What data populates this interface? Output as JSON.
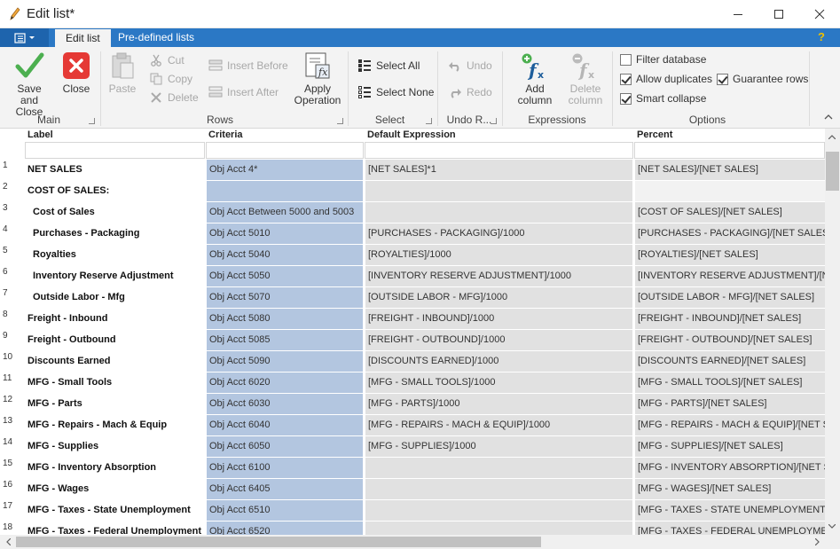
{
  "window": {
    "title": "Edit list*",
    "icons": {
      "app": "pencil-icon",
      "minimize": "minimize-icon",
      "maximize": "maximize-icon",
      "close": "close-icon"
    }
  },
  "tabs": [
    {
      "label": "Edit list",
      "active": true
    },
    {
      "label": "Pre-defined lists",
      "active": false
    }
  ],
  "help": "?",
  "ribbon": {
    "groups": {
      "main": "Main",
      "rows": "Rows",
      "select": "Select",
      "undo": "Undo R...",
      "expressions": "Expressions",
      "options": "Options"
    },
    "buttons": {
      "save_and_close": "Save and\nClose",
      "close": "Close",
      "paste": "Paste",
      "cut": "Cut",
      "copy": "Copy",
      "delete": "Delete",
      "insert_before": "Insert Before",
      "insert_after": "Insert After",
      "apply_operation": "Apply\nOperation",
      "select_all": "Select All",
      "select_none": "Select None",
      "undo": "Undo",
      "redo": "Redo",
      "add_column": "Add column",
      "delete_column": "Delete\ncolumn"
    },
    "options": {
      "filter_database": {
        "label": "Filter database",
        "checked": false
      },
      "allow_duplicates": {
        "label": "Allow duplicates",
        "checked": true
      },
      "guarantee_rows": {
        "label": "Guarantee rows",
        "checked": true
      },
      "smart_collapse": {
        "label": "Smart collapse",
        "checked": true
      }
    }
  },
  "grid": {
    "columns": [
      "Label",
      "Criteria",
      "Default Expression",
      "Percent"
    ],
    "rows": [
      {
        "n": "1",
        "label": "NET SALES",
        "indent": false,
        "criteria": "Obj Acct 4*",
        "expr": "[NET SALES]*1",
        "pct": "[NET SALES]/[NET SALES]"
      },
      {
        "n": "2",
        "label": "COST OF SALES:",
        "indent": false,
        "criteria": "",
        "expr": "",
        "pct": ""
      },
      {
        "n": "3",
        "label": "Cost of Sales",
        "indent": true,
        "criteria": "Obj Acct Between 5000 and 5003",
        "expr": "",
        "pct": "[COST OF SALES]/[NET SALES]"
      },
      {
        "n": "4",
        "label": "Purchases - Packaging",
        "indent": true,
        "criteria": "Obj Acct 5010",
        "expr": "[PURCHASES - PACKAGING]/1000",
        "pct": "[PURCHASES - PACKAGING]/[NET SALES]"
      },
      {
        "n": "5",
        "label": "Royalties",
        "indent": true,
        "criteria": "Obj Acct 5040",
        "expr": "[ROYALTIES]/1000",
        "pct": "[ROYALTIES]/[NET SALES]"
      },
      {
        "n": "6",
        "label": "Inventory Reserve Adjustment",
        "indent": true,
        "criteria": "Obj Acct 5050",
        "expr": "[INVENTORY RESERVE ADJUSTMENT]/1000",
        "pct": "[INVENTORY RESERVE ADJUSTMENT]/[NET SALES]"
      },
      {
        "n": "7",
        "label": "Outside Labor - Mfg",
        "indent": true,
        "criteria": "Obj Acct 5070",
        "expr": "[OUTSIDE LABOR - MFG]/1000",
        "pct": "[OUTSIDE LABOR - MFG]/[NET SALES]"
      },
      {
        "n": "8",
        "label": "Freight - Inbound",
        "indent": false,
        "criteria": "Obj Acct 5080",
        "expr": "[FREIGHT - INBOUND]/1000",
        "pct": "[FREIGHT - INBOUND]/[NET SALES]"
      },
      {
        "n": "9",
        "label": "Freight - Outbound",
        "indent": false,
        "criteria": "Obj Acct 5085",
        "expr": "[FREIGHT - OUTBOUND]/1000",
        "pct": "[FREIGHT - OUTBOUND]/[NET SALES]"
      },
      {
        "n": "10",
        "label": "Discounts Earned",
        "indent": false,
        "criteria": "Obj Acct 5090",
        "expr": "[DISCOUNTS EARNED]/1000",
        "pct": "[DISCOUNTS EARNED]/[NET SALES]"
      },
      {
        "n": "11",
        "label": "MFG - Small Tools",
        "indent": false,
        "criteria": "Obj Acct 6020",
        "expr": "[MFG - SMALL TOOLS]/1000",
        "pct": "[MFG - SMALL TOOLS]/[NET SALES]"
      },
      {
        "n": "12",
        "label": "MFG - Parts",
        "indent": false,
        "criteria": "Obj Acct 6030",
        "expr": "[MFG - PARTS]/1000",
        "pct": "[MFG - PARTS]/[NET SALES]"
      },
      {
        "n": "13",
        "label": "MFG - Repairs - Mach & Equip",
        "indent": false,
        "criteria": "Obj Acct 6040",
        "expr": "[MFG - REPAIRS - MACH & EQUIP]/1000",
        "pct": "[MFG - REPAIRS - MACH & EQUIP]/[NET SALES]"
      },
      {
        "n": "14",
        "label": "MFG - Supplies",
        "indent": false,
        "criteria": "Obj Acct 6050",
        "expr": "[MFG - SUPPLIES]/1000",
        "pct": "[MFG - SUPPLIES]/[NET SALES]"
      },
      {
        "n": "15",
        "label": "MFG - Inventory Absorption",
        "indent": false,
        "criteria": "Obj Acct 6100",
        "expr": "",
        "pct": "[MFG - INVENTORY ABSORPTION]/[NET SALES]"
      },
      {
        "n": "16",
        "label": "MFG - Wages",
        "indent": false,
        "criteria": "Obj Acct 6405",
        "expr": "",
        "pct": "[MFG - WAGES]/[NET SALES]"
      },
      {
        "n": "17",
        "label": "MFG - Taxes - State Unemployment",
        "indent": false,
        "criteria": "Obj Acct 6510",
        "expr": "",
        "pct": "[MFG - TAXES - STATE UNEMPLOYMENT]/[NET SALES]"
      },
      {
        "n": "18",
        "label": "MFG - Taxes - Federal Unemployment",
        "indent": false,
        "criteria": "Obj Acct 6520",
        "expr": "",
        "pct": "[MFG - TAXES - FEDERAL UNEMPLOYMENT]/[NET SALES]"
      }
    ]
  },
  "colors": {
    "ribbon_blue": "#2b78c5",
    "criteria_bg": "#b3c6e0",
    "expression_bg": "#e1e1e1",
    "save_check_green": "#4caf50",
    "close_red": "#e53935"
  }
}
